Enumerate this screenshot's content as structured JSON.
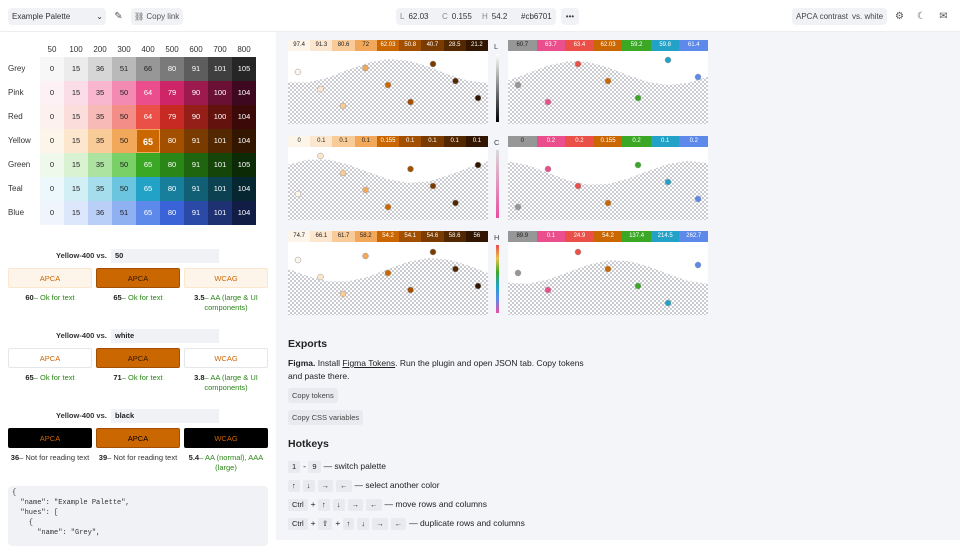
{
  "topbar": {
    "palette": "Example Palette",
    "copy_link": "Copy link",
    "L_label": "L",
    "L": "62.03",
    "C_label": "C",
    "C": "0.155",
    "H_label": "H",
    "H": "54.2",
    "hex": "#cb6701",
    "more": "•••",
    "apca_contrast": "APCA contrast",
    "vs_white": "vs. white"
  },
  "grid": {
    "columns": [
      "50",
      "100",
      "200",
      "300",
      "400",
      "500",
      "600",
      "700",
      "800"
    ],
    "rows": [
      {
        "name": "Grey",
        "values": [
          "0",
          "15",
          "36",
          "51",
          "66",
          "80",
          "91",
          "101",
          "105"
        ],
        "colors": [
          "#f7f7f7",
          "#ececec",
          "#d6d6d6",
          "#b9b9b9",
          "#979797",
          "#7a7a7a",
          "#5d5d5d",
          "#3f3f3f",
          "#262626"
        ]
      },
      {
        "name": "Pink",
        "values": [
          "0",
          "15",
          "35",
          "50",
          "64",
          "79",
          "90",
          "100",
          "104"
        ],
        "colors": [
          "#fdf1f5",
          "#fbdde8",
          "#f8b7cf",
          "#f28ab1",
          "#ea4e8c",
          "#cd2568",
          "#9c1a4e",
          "#6a1035",
          "#3e0820"
        ]
      },
      {
        "name": "Red",
        "values": [
          "0",
          "15",
          "35",
          "50",
          "64",
          "79",
          "90",
          "100",
          "104"
        ],
        "colors": [
          "#fdf1f0",
          "#fbdedc",
          "#f8bab6",
          "#f38d87",
          "#eb5048",
          "#c62a22",
          "#941e18",
          "#64120e",
          "#3b0a08"
        ]
      },
      {
        "name": "Yellow",
        "values": [
          "0",
          "15",
          "35",
          "50",
          "65",
          "80",
          "91",
          "101",
          "104"
        ],
        "colors": [
          "#fdf4ea",
          "#fce6cd",
          "#f8cb98",
          "#f2a85b",
          "#cb6701",
          "#a24f00",
          "#7a3b00",
          "#532700",
          "#321600"
        ]
      },
      {
        "name": "Green",
        "values": [
          "0",
          "15",
          "35",
          "50",
          "65",
          "80",
          "91",
          "101",
          "105"
        ],
        "colors": [
          "#eef9ec",
          "#d8f2d2",
          "#ade3a1",
          "#79d067",
          "#3aa825",
          "#2a8617",
          "#1f650f",
          "#154509",
          "#0c2a05"
        ]
      },
      {
        "name": "Teal",
        "values": [
          "0",
          "15",
          "35",
          "50",
          "65",
          "80",
          "91",
          "101",
          "104"
        ],
        "colors": [
          "#ecf8fb",
          "#d3eff6",
          "#a5ddec",
          "#6cc5de",
          "#21a2c6",
          "#177f9c",
          "#115f75",
          "#0b4150",
          "#062731"
        ]
      },
      {
        "name": "Blue",
        "values": [
          "0",
          "15",
          "36",
          "51",
          "65",
          "80",
          "91",
          "101",
          "104"
        ],
        "colors": [
          "#eff4fd",
          "#dce7fb",
          "#b9cff7",
          "#8fb0f1",
          "#5c89ea",
          "#3a63d7",
          "#2b49a6",
          "#1e3273",
          "#111d45"
        ]
      }
    ]
  },
  "comparisons": [
    {
      "title": "Yellow-400 vs.",
      "against": "50",
      "boxes": [
        {
          "label": "APCA",
          "score": "60",
          "desc": "– Ok for text"
        },
        {
          "label": "APCA",
          "score": "65",
          "desc": "– Ok for text"
        },
        {
          "label": "WCAG",
          "score": "3.5",
          "desc": "– AA (large & UI components)"
        }
      ]
    },
    {
      "title": "Yellow-400 vs.",
      "against": "white",
      "boxes": [
        {
          "label": "APCA",
          "score": "65",
          "desc": "– Ok for text"
        },
        {
          "label": "APCA",
          "score": "71",
          "desc": "– Ok for text"
        },
        {
          "label": "WCAG",
          "score": "3.8",
          "desc": "– AA (large & UI components)"
        }
      ]
    },
    {
      "title": "Yellow-400 vs.",
      "against": "black",
      "boxes": [
        {
          "label": "APCA",
          "score": "36",
          "desc": "– Not for reading text"
        },
        {
          "label": "APCA",
          "score": "39",
          "desc": "– Not for reading text"
        },
        {
          "label": "WCAG",
          "score": "5.4",
          "desc": "– AA (normal), AAA (large)"
        }
      ]
    }
  ],
  "json_preview": "{\n  \"name\": \"Example Palette\",\n  \"hues\": [\n    {\n      \"name\": \"Grey\",",
  "charts": {
    "L_axis": "L",
    "C_axis": "C",
    "H_axis": "H",
    "L_left": [
      "97.4",
      "91.3",
      "80.6",
      "72",
      "62.03",
      "50.8",
      "40.7",
      "28.5",
      "21.2"
    ],
    "L_right": [
      "60.7",
      "63.7",
      "63.4",
      "62.03",
      "59.2",
      "59.8",
      "61.4"
    ],
    "C_left": [
      "0",
      "0.1",
      "0.1",
      "0.1",
      "0.155",
      "0.1",
      "0.1",
      "0.1",
      "0.1"
    ],
    "C_right": [
      "0",
      "0.2",
      "0.2",
      "0.155",
      "0.2",
      "0.1",
      "0.2"
    ],
    "H_left": [
      "74.7",
      "66.1",
      "61.7",
      "58.2",
      "54.2",
      "54.1",
      "54.6",
      "58.6",
      "56"
    ],
    "H_right": [
      "89.9",
      "0.1",
      "24.9",
      "54.2",
      "137.4",
      "214.5",
      "262.7"
    ],
    "left_colors": [
      "#fdf4ea",
      "#fce6cd",
      "#f8cb98",
      "#f2a85b",
      "#cb6701",
      "#a24f00",
      "#7a3b00",
      "#532700",
      "#321600"
    ],
    "right_colors": [
      "#979797",
      "#ea4e8c",
      "#eb5048",
      "#cb6701",
      "#3aa825",
      "#21a2c6",
      "#5c89ea"
    ]
  },
  "exports": {
    "title": "Exports",
    "figma_bold": "Figma.",
    "figma_pre": "Install",
    "figma_link": "Figma Tokens",
    "figma_post": ". Run the plugin and open JSON tab. Copy tokens and paste there.",
    "copy_tokens": "Copy tokens",
    "copy_css": "Copy CSS variables"
  },
  "hotkeys": {
    "title": "Hotkeys",
    "h1": {
      "k1": "1",
      "sep": "-",
      "k2": "9",
      "desc": "— switch palette"
    },
    "h2": {
      "keys": [
        "↑",
        "↓",
        "→",
        "←"
      ],
      "desc": "— select another color"
    },
    "h3": {
      "mod": "Ctrl",
      "plus": "+",
      "keys": [
        "↑",
        "↓",
        "→",
        "←"
      ],
      "desc": "— move rows and columns"
    },
    "h4": {
      "mod": "Ctrl",
      "plus": "+",
      "mod2": "⇧",
      "keys": [
        "↑",
        "↓",
        "→",
        "←"
      ],
      "desc": "— duplicate rows and columns"
    }
  }
}
